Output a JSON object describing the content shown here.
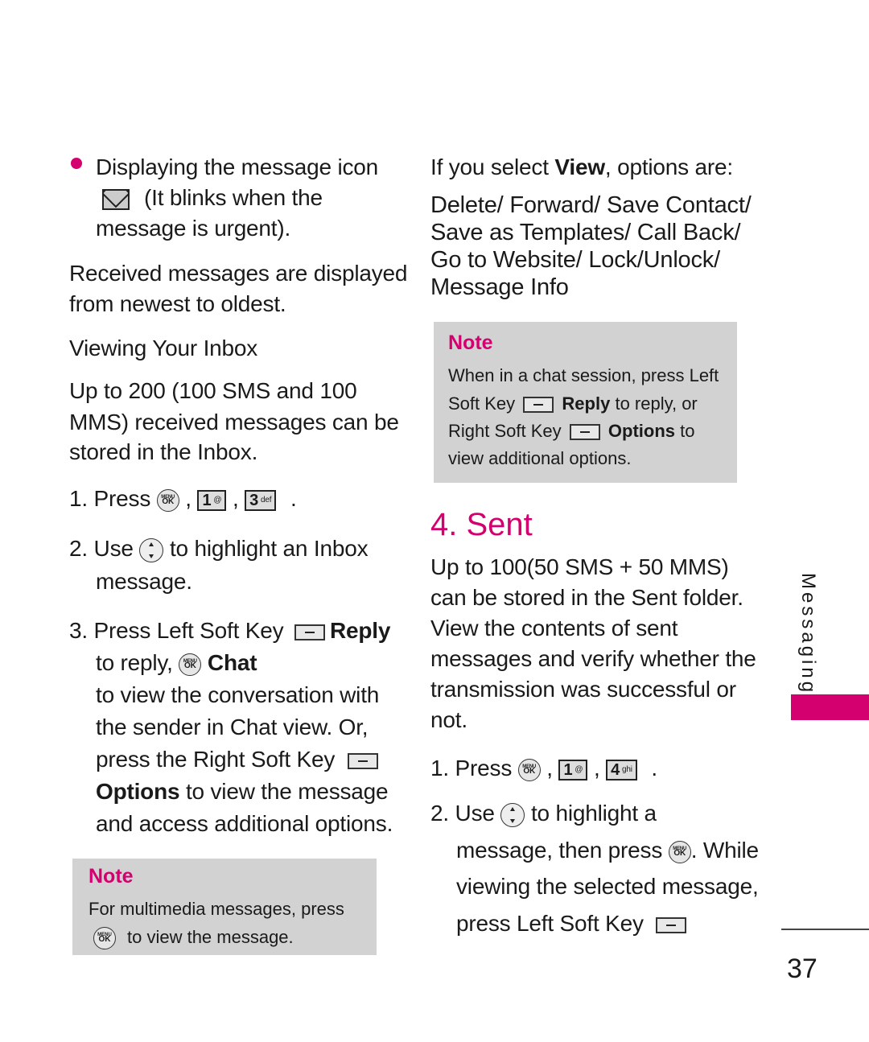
{
  "page": {
    "number": "37",
    "side_tab": "Messaging",
    "accent_color": "#d4006f",
    "note_bg_color": "#d2d2d2"
  },
  "left": {
    "bullet": {
      "line1": "Displaying the message icon",
      "line2": "(It blinks when the",
      "line3": "message is urgent).",
      "icon": "envelope-icon"
    },
    "received": {
      "line1": "Received messages are displayed",
      "line2": "from newest to oldest."
    },
    "heading": "Viewing Your Inbox",
    "capacity": {
      "line1": "Up to 200 (100 SMS and 100",
      "line2": "MMS) received messages can be",
      "line3": "stored in the Inbox."
    },
    "steps": [
      {
        "num": "1.",
        "text": "Press",
        "keys": [
          "MENU OK",
          "1",
          "3 def"
        ]
      },
      {
        "num": "2.",
        "text_before": "Use",
        "text_after": "to highlight an Inbox",
        "line2": "message."
      },
      {
        "num": "3.",
        "line1": "Press Left Soft Key",
        "reply": "Reply",
        "line2a": "to reply,",
        "chat": "Chat",
        "line3": "to view the conversation with",
        "line4": "the sender in Chat view. Or,",
        "line5": "press the Right Soft Key",
        "options": "Options",
        "line6": "to view the message",
        "line7": "and access additional options."
      }
    ],
    "note": {
      "title": "Note",
      "line1": "For multimedia messages, press",
      "line2": "to view the message."
    }
  },
  "right": {
    "view_intro": {
      "a": "If you select",
      "b": "View",
      "c": ", options are:"
    },
    "view_options": {
      "line1": "Delete/ Forward/ Save Contact/",
      "line2": "Save as Templates/ Call Back/",
      "line3": "Go to Website/ Lock/Unlock/",
      "line4": "Message Info"
    },
    "note": {
      "title": "Note",
      "line1": "When in a chat session, press Left",
      "line2a": "Soft Key",
      "reply": "Reply",
      "line2b": "to reply, or",
      "line3a": "Right Soft Key",
      "options": "Options",
      "line3b": "to",
      "line4": "view additional options."
    },
    "section_title": "4. Sent",
    "sent_desc": {
      "line1": "Up to 100(50 SMS + 50 MMS)",
      "line2": "can be stored in the Sent folder.",
      "line3": "View the contents of sent",
      "line4": "messages and verify whether the",
      "line5": "transmission was successful or",
      "line6": "not."
    },
    "steps": [
      {
        "num": "1.",
        "text": "Press",
        "keys": [
          "MENU OK",
          "1",
          "4 ghi"
        ]
      },
      {
        "num": "2.",
        "text_before": "Use",
        "text_after": "to highlight a",
        "line2a": "message, then press",
        "line2b": ". While",
        "line3": "viewing the selected message,",
        "line4": "press Left Soft Key"
      }
    ]
  },
  "keys": {
    "ok_top": "MENU",
    "ok_bottom": "OK",
    "one": "1",
    "one_sub": "@",
    "three": "3",
    "three_sub": "def",
    "four": "4",
    "four_sub": "ghi"
  }
}
